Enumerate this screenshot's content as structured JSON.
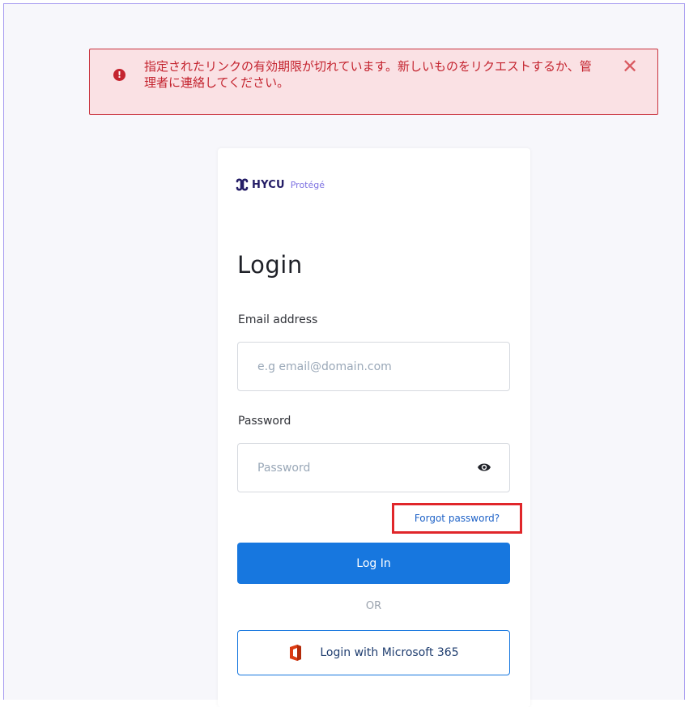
{
  "alert": {
    "message": "指定されたリンクの有効期限が切れています。新しいものをリクエストするか、管理者に連絡してください。",
    "icon": "exclamation-circle-icon",
    "close_label": "✕",
    "color": "#c4242f"
  },
  "logo": {
    "brand": "HYCU",
    "product": "Protégé"
  },
  "login": {
    "title": "Login",
    "email_label": "Email address",
    "email_placeholder": "e.g email@domain.com",
    "password_label": "Password",
    "password_placeholder": "Password",
    "forgot_link": "Forgot password?",
    "login_button": "Log In",
    "or_text": "OR",
    "microsoft_button": "Login with Microsoft 365"
  },
  "colors": {
    "primary": "#1777df",
    "highlight_box": "#e0262a",
    "brand_accent": "#7e72e2"
  }
}
